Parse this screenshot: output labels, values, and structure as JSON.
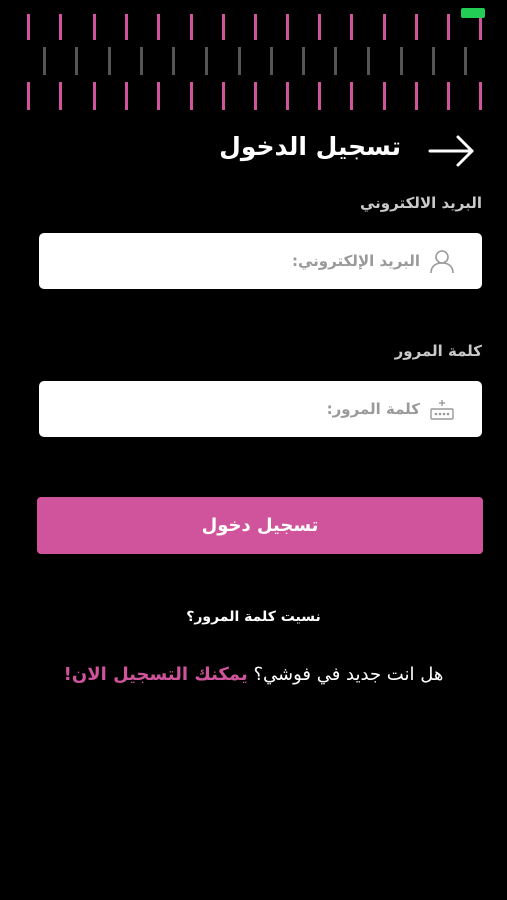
{
  "status_bar": {
    "battery_color": "#22cc55"
  },
  "header": {
    "title": "تسجيل الدخول",
    "back_icon": "arrow-right-icon"
  },
  "form": {
    "email": {
      "label": "البريد الالكتروني",
      "placeholder": "البريد الإلكتروني:",
      "value": "",
      "icon": "user-icon"
    },
    "password": {
      "label": "كلمة المرور",
      "placeholder": "كلمة المرور:",
      "value": "",
      "icon": "password-dots-icon"
    },
    "submit_label": "تسجيل دخول"
  },
  "links": {
    "forgot_password": "نسيت كلمة المرور؟",
    "signup_question": "هل انت جديد في فوشي؟",
    "signup_action": "يمكنك التسجيل الان!"
  },
  "colors": {
    "accent": "#cf549b",
    "background": "#000000",
    "input_bg": "#ffffff",
    "stripe_gray": "#555555"
  }
}
